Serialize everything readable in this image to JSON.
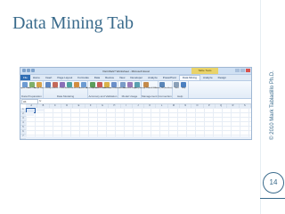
{
  "slide": {
    "title": "Data Mining Tab",
    "credit": "© 2010 Mark Tabladillo Ph.D.",
    "page_number": "14",
    "accent_color": "#3a6b8c"
  },
  "window": {
    "title": "Visit Mark? Worksheet - Microsoft Excel",
    "context_group": "Table Tools"
  },
  "tabs": [
    "File",
    "Home",
    "Insert",
    "Page Layout",
    "Formulas",
    "Data",
    "Review",
    "View",
    "Developer",
    "Analyze",
    "PowerPivot",
    "Data Mining",
    "Analyze",
    "Design"
  ],
  "active_tab": "Data Mining",
  "ribbon_groups": [
    {
      "label": "Data Preparation",
      "buttons": [
        {
          "label": "Explore Data",
          "color": "#6c9bd2"
        },
        {
          "label": "Clean Data",
          "color": "#7fb06a"
        },
        {
          "label": "Sample Data",
          "color": "#d8a24a"
        }
      ]
    },
    {
      "label": "Data Modeling",
      "buttons": [
        {
          "label": "Classify",
          "color": "#5d86c2"
        },
        {
          "label": "Estimate",
          "color": "#c46a5a"
        },
        {
          "label": "Cluster",
          "color": "#8a6fb8"
        },
        {
          "label": "Associate",
          "color": "#4fa3a0"
        },
        {
          "label": "Forecast",
          "color": "#d28d3f"
        },
        {
          "label": "Advanced",
          "color": "#6c9bd2"
        }
      ]
    },
    {
      "label": "Accuracy and Validation",
      "buttons": [
        {
          "label": "Accuracy Chart",
          "color": "#5c9e5c"
        },
        {
          "label": "Classification Matrix",
          "color": "#c75a5a"
        },
        {
          "label": "Profit Chart",
          "color": "#d9b24a"
        },
        {
          "label": "Cross-Validation",
          "color": "#6a8fc9"
        }
      ]
    },
    {
      "label": "Model Usage",
      "buttons": [
        {
          "label": "Browse",
          "color": "#7a9cc8"
        },
        {
          "label": "Document Model",
          "color": "#9a7ab8"
        },
        {
          "label": "Query",
          "color": "#5aa0b0"
        }
      ]
    },
    {
      "label": "Management",
      "buttons": [
        {
          "label": "Manage Models",
          "color": "#c48a4a"
        }
      ]
    },
    {
      "label": "Connection",
      "buttons": [
        {
          "label": "DMAddins_DB (localhost)",
          "color": "#5a86b8"
        }
      ]
    },
    {
      "label": "Help",
      "buttons": [
        {
          "label": "Trace",
          "color": "#8aa0b8"
        },
        {
          "label": "Help",
          "color": "#4a7fc0"
        }
      ]
    }
  ],
  "formula_bar": {
    "name_box": "A1",
    "fx": "fx"
  },
  "columns": [
    "A",
    "B",
    "C",
    "D",
    "E",
    "F",
    "G",
    "H",
    "I",
    "J",
    "K",
    "L",
    "M",
    "N",
    "O",
    "P",
    "Q",
    "R",
    "S"
  ],
  "rows": [
    "1",
    "2",
    "3",
    "4",
    "5",
    "6",
    "7",
    "8"
  ]
}
